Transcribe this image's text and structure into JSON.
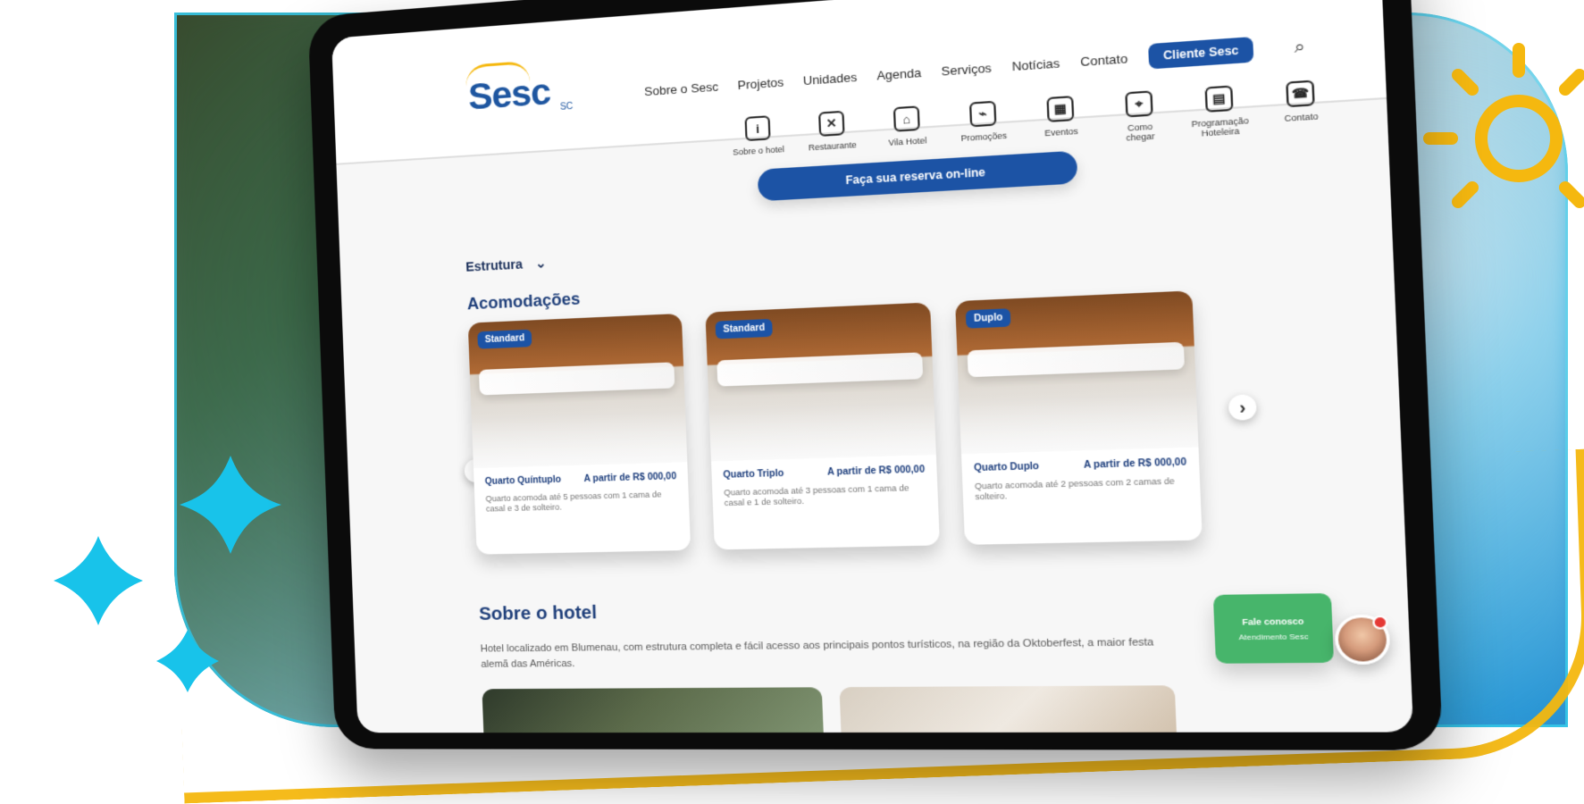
{
  "header": {
    "logo": {
      "brand": "Sesc",
      "sub": "SC"
    },
    "menu_items": [
      "Sobre o Sesc",
      "Projetos",
      "Unidades",
      "Agenda",
      "Serviços",
      "Notícias",
      "Contato"
    ],
    "cta": "Cliente Sesc"
  },
  "subnav": {
    "items": [
      {
        "label": "Sobre o hotel",
        "icon": "info-icon"
      },
      {
        "label": "Restaurante",
        "icon": "cutlery-icon"
      },
      {
        "label": "Vila Hotel",
        "icon": "home-icon"
      },
      {
        "label": "Promoções",
        "icon": "tag-icon"
      },
      {
        "label": "Eventos",
        "icon": "calendar-icon"
      },
      {
        "label": "Como chegar",
        "icon": "map-pin-icon"
      },
      {
        "label": "Programação Hoteleira",
        "icon": "calendar-icon"
      },
      {
        "label": "Contato",
        "icon": "phone-icon"
      }
    ]
  },
  "reserve_button": "Faça sua reserva on-line",
  "content": {
    "breadcrumb": "Estrutura",
    "section_title": "Acomodações",
    "cards": [
      {
        "tag": "Standard",
        "title": "Quarto Quíntuplo",
        "price": "A partir de R$ 000,00",
        "desc": "Quarto acomoda até 5 pessoas com 1 cama de casal e 3 de solteiro."
      },
      {
        "tag": "Standard",
        "title": "Quarto Triplo",
        "price": "A partir de R$ 000,00",
        "desc": "Quarto acomoda até 3 pessoas com 1 cama de casal e 1 de solteiro."
      },
      {
        "tag": "Duplo",
        "title": "Quarto Duplo",
        "price": "A partir de R$ 000,00",
        "desc": "Quarto acomoda até 2 pessoas com 2 camas de solteiro."
      }
    ],
    "about_title": "Sobre o hotel",
    "about_text": "Hotel localizado em Blumenau, com estrutura completa e fácil acesso aos principais pontos turísticos, na região da Oktoberfest, a maior festa alemã das Américas."
  },
  "chat": {
    "title": "Fale conosco",
    "subtitle": "Atendimento Sesc"
  },
  "colors": {
    "brand_blue": "#1c53a5",
    "cyan": "#39c6e6",
    "yellow": "#f5b80f",
    "green": "#47b56b"
  }
}
